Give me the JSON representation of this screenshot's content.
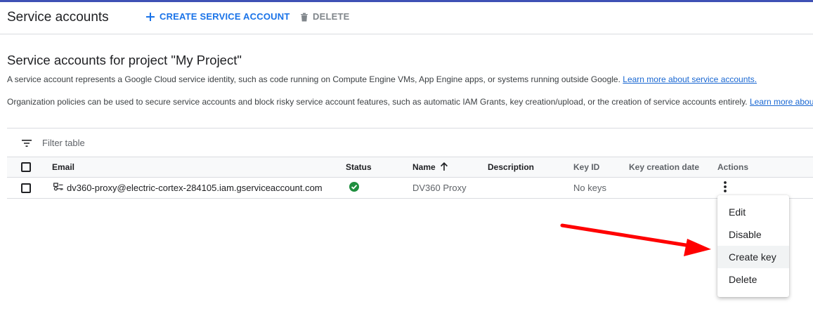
{
  "header": {
    "title": "Service accounts",
    "create_label": "CREATE SERVICE ACCOUNT",
    "delete_label": "DELETE",
    "accent_color": "#1a73e8"
  },
  "section": {
    "title": "Service accounts for project \"My Project\"",
    "desc1_text": "A service account represents a Google Cloud service identity, such as code running on Compute Engine VMs, App Engine apps, or systems running outside Google. ",
    "desc1_link": "Learn more about service accounts.",
    "desc2_text": "Organization policies can be used to secure service accounts and block risky service account features, such as automatic IAM Grants, key creation/upload, or the creation of service accounts entirely. ",
    "desc2_link": "Learn more abou"
  },
  "filter": {
    "placeholder": "Filter table"
  },
  "table": {
    "columns": {
      "email": "Email",
      "status": "Status",
      "name": "Name",
      "description": "Description",
      "key_id": "Key ID",
      "key_creation_date": "Key creation date",
      "actions": "Actions"
    },
    "sort": {
      "column": "name",
      "direction": "ascending"
    },
    "rows": [
      {
        "email": "dv360-proxy@electric-cortex-284105.iam.gserviceaccount.com",
        "status": "enabled",
        "status_color": "#1e8e3e",
        "name": "DV360 Proxy",
        "description": "",
        "key_id": "No keys",
        "key_creation_date": ""
      }
    ]
  },
  "actions_menu": {
    "items": [
      {
        "label": "Edit"
      },
      {
        "label": "Disable"
      },
      {
        "label": "Create key",
        "highlighted": true
      },
      {
        "label": "Delete"
      }
    ]
  },
  "annotation": {
    "arrow_color": "#ff0000"
  },
  "icons": {
    "add": "plus-icon",
    "delete": "trash-icon",
    "filter": "filter-icon",
    "sort": "arrow-up-icon",
    "service_account": "service-account-key-icon",
    "status": "check-circle-icon",
    "more": "more-vert-icon"
  }
}
